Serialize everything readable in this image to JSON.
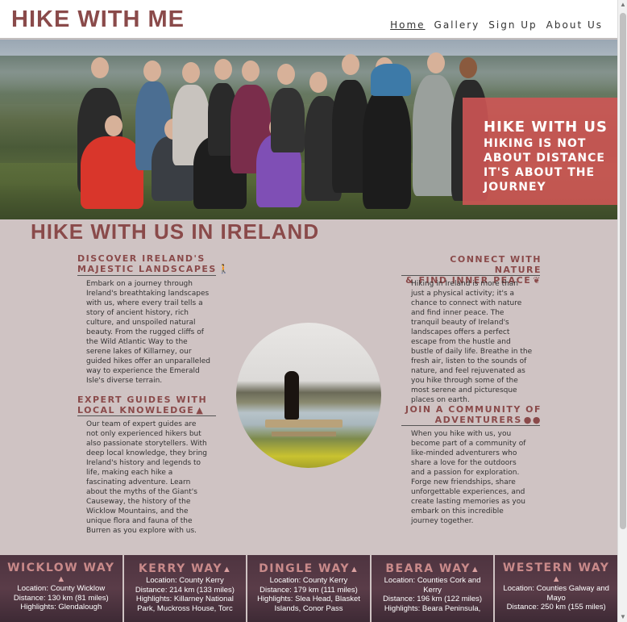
{
  "header": {
    "logo": "HIKE WITH ME",
    "nav": [
      {
        "label": "Home",
        "active": true
      },
      {
        "label": "Gallery",
        "active": false
      },
      {
        "label": "Sign Up",
        "active": false
      },
      {
        "label": "About Us",
        "active": false
      }
    ]
  },
  "hero": {
    "overlay_line1": "HIKE WITH US",
    "overlay_line2": "HIKING IS NOT",
    "overlay_line3": "ABOUT DISTANCE",
    "overlay_line4": "IT'S ABOUT THE",
    "overlay_line5": "JOURNEY"
  },
  "main_title": "HIKE WITH US IN IRELAND",
  "sections": {
    "discover": {
      "title_1": "DISCOVER IRELAND'S",
      "title_2": "MAJESTIC LANDSCAPES",
      "icon": "hiker-icon",
      "text": "Embark on a journey through Ireland's breathtaking landscapes with us, where every trail tells a story of ancient history, rich culture, and unspoiled natural beauty. From the rugged cliffs of the Wild Atlantic Way to the serene lakes of Killarney, our guided hikes offer an unparalleled way to experience the Emerald Isle's diverse terrain."
    },
    "guides": {
      "title_1": "EXPERT GUIDES WITH",
      "title_2": "LOCAL KNOWLEDGE",
      "icon": "mountain-icon",
      "text": "Our team of expert guides are not only experienced hikers but also passionate storytellers. With deep local knowledge, they bring Ireland's history and legends to life, making each hike a fascinating adventure. Learn about the myths of the Giant's Causeway, the history of the Wicklow Mountains, and the unique flora and fauna of the Burren as you explore with us."
    },
    "nature": {
      "title_1": "CONNECT WITH NATURE",
      "title_2": "& FIND INNER PEACE",
      "icon": "dove-icon",
      "text": "Hiking in Ireland is more than just a physical activity; it's a chance to connect with nature and find inner peace. The tranquil beauty of Ireland's landscapes offers a perfect escape from the hustle and bustle of daily life. Breathe in the fresh air, listen to the sounds of nature, and feel rejuvenated as you hike through some of the most serene and picturesque places on earth."
    },
    "community": {
      "title_1": "JOIN A COMMUNITY OF",
      "title_2": "ADVENTURERS",
      "icon": "group-icon",
      "text": "When you hike with us, you become part of a community of like-minded adventurers who share a love for the outdoors and a passion for exploration. Forge new friendships, share unforgettable experiences, and create lasting memories as you embark on this incredible journey together."
    }
  },
  "cards": [
    {
      "title": "WICKLOW WAY",
      "lines": [
        "Location: County Wicklow",
        "Distance: 130 km (81 miles)",
        "Highlights: Glendalough"
      ]
    },
    {
      "title": "KERRY WAY",
      "lines": [
        "Location: County Kerry",
        "Distance: 214 km (133 miles)",
        "Highlights: Killarney National",
        "Park, Muckross House, Torc"
      ]
    },
    {
      "title": "DINGLE WAY",
      "lines": [
        "Location: County Kerry",
        "Distance: 179 km (111 miles)",
        "Highlights: Slea Head, Blasket",
        "Islands, Conor Pass"
      ]
    },
    {
      "title": "BEARA WAY",
      "lines": [
        "Location: Counties Cork and",
        "Kerry",
        "Distance: 196 km (122 miles)",
        "Highlights: Beara Peninsula,"
      ]
    },
    {
      "title": "WESTERN WAY",
      "lines": [
        "Location: Counties Galway and",
        "Mayo",
        "Distance: 250 km (155 miles)"
      ]
    }
  ],
  "colors": {
    "accent": "#8a4a4a",
    "background": "#cfc3c3",
    "hero_overlay": "#d25555",
    "card_bg": "#4e3440"
  }
}
